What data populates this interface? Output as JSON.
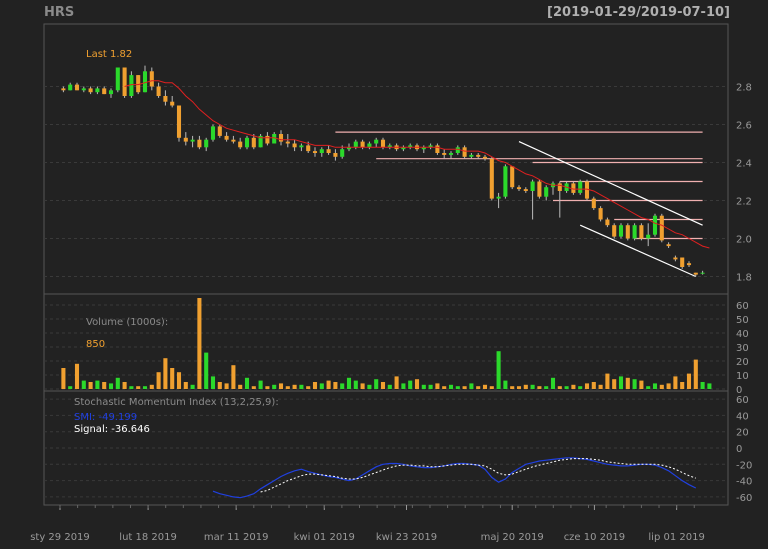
{
  "header": {
    "ticker": "HRS",
    "date_range": "[2019-01-29/2019-07-10]"
  },
  "colors": {
    "bg": "#222222",
    "panel": "#222222",
    "up": "#2bd92b",
    "down": "#f0a030",
    "grid": "#3a3a3a",
    "axis": "#999999",
    "sma": "#e02020",
    "smi": "#2040e0",
    "signal": "#ffffff",
    "hline": "#f0b0b0",
    "trend": "#ffffff",
    "last": "#f0a030"
  },
  "chart_data": [
    {
      "type": "candlestick",
      "panel": "price",
      "ylim": [
        1.75,
        2.95
      ],
      "yticks": [
        1.8,
        2.0,
        2.2,
        2.4,
        2.6,
        2.8
      ],
      "last_label": "Last 1.82",
      "sma_label": "",
      "candles": [
        [
          2.79,
          2.8,
          2.77,
          2.78
        ],
        [
          2.78,
          2.82,
          2.78,
          2.81
        ],
        [
          2.81,
          2.82,
          2.78,
          2.78
        ],
        [
          2.78,
          2.8,
          2.77,
          2.79
        ],
        [
          2.79,
          2.8,
          2.76,
          2.77
        ],
        [
          2.77,
          2.8,
          2.76,
          2.79
        ],
        [
          2.79,
          2.8,
          2.76,
          2.76
        ],
        [
          2.76,
          2.79,
          2.74,
          2.78
        ],
        [
          2.78,
          2.9,
          2.77,
          2.9
        ],
        [
          2.9,
          2.9,
          2.74,
          2.75
        ],
        [
          2.75,
          2.88,
          2.74,
          2.86
        ],
        [
          2.86,
          2.86,
          2.76,
          2.77
        ],
        [
          2.77,
          2.91,
          2.77,
          2.88
        ],
        [
          2.88,
          2.9,
          2.78,
          2.8
        ],
        [
          2.8,
          2.82,
          2.74,
          2.75
        ],
        [
          2.75,
          2.78,
          2.7,
          2.72
        ],
        [
          2.72,
          2.75,
          2.69,
          2.7
        ],
        [
          2.7,
          2.7,
          2.51,
          2.53
        ],
        [
          2.53,
          2.56,
          2.49,
          2.51
        ],
        [
          2.51,
          2.54,
          2.48,
          2.52
        ],
        [
          2.52,
          2.54,
          2.47,
          2.48
        ],
        [
          2.48,
          2.53,
          2.46,
          2.52
        ],
        [
          2.52,
          2.6,
          2.51,
          2.59
        ],
        [
          2.59,
          2.6,
          2.53,
          2.54
        ],
        [
          2.54,
          2.56,
          2.51,
          2.52
        ],
        [
          2.52,
          2.54,
          2.5,
          2.51
        ],
        [
          2.51,
          2.53,
          2.47,
          2.48
        ],
        [
          2.48,
          2.54,
          2.47,
          2.53
        ],
        [
          2.53,
          2.55,
          2.47,
          2.48
        ],
        [
          2.48,
          2.55,
          2.48,
          2.54
        ],
        [
          2.54,
          2.56,
          2.49,
          2.5
        ],
        [
          2.5,
          2.56,
          2.5,
          2.55
        ],
        [
          2.55,
          2.57,
          2.49,
          2.51
        ],
        [
          2.51,
          2.55,
          2.48,
          2.5
        ],
        [
          2.5,
          2.52,
          2.46,
          2.48
        ],
        [
          2.48,
          2.5,
          2.46,
          2.49
        ],
        [
          2.49,
          2.51,
          2.45,
          2.46
        ],
        [
          2.46,
          2.48,
          2.43,
          2.45
        ],
        [
          2.45,
          2.48,
          2.43,
          2.47
        ],
        [
          2.47,
          2.49,
          2.44,
          2.45
        ],
        [
          2.45,
          2.47,
          2.41,
          2.43
        ],
        [
          2.43,
          2.49,
          2.42,
          2.47
        ],
        [
          2.47,
          2.5,
          2.46,
          2.48
        ],
        [
          2.48,
          2.52,
          2.47,
          2.51
        ],
        [
          2.51,
          2.52,
          2.47,
          2.48
        ],
        [
          2.48,
          2.51,
          2.47,
          2.5
        ],
        [
          2.5,
          2.53,
          2.48,
          2.52
        ],
        [
          2.52,
          2.53,
          2.47,
          2.48
        ],
        [
          2.48,
          2.5,
          2.47,
          2.49
        ],
        [
          2.49,
          2.5,
          2.46,
          2.47
        ],
        [
          2.47,
          2.49,
          2.46,
          2.48
        ],
        [
          2.48,
          2.5,
          2.47,
          2.49
        ],
        [
          2.49,
          2.5,
          2.46,
          2.47
        ],
        [
          2.47,
          2.49,
          2.45,
          2.48
        ],
        [
          2.48,
          2.5,
          2.47,
          2.49
        ],
        [
          2.49,
          2.5,
          2.44,
          2.45
        ],
        [
          2.45,
          2.47,
          2.42,
          2.44
        ],
        [
          2.44,
          2.46,
          2.42,
          2.45
        ],
        [
          2.45,
          2.49,
          2.44,
          2.48
        ],
        [
          2.48,
          2.49,
          2.42,
          2.43
        ],
        [
          2.43,
          2.45,
          2.42,
          2.44
        ],
        [
          2.44,
          2.45,
          2.42,
          2.43
        ],
        [
          2.43,
          2.44,
          2.41,
          2.42
        ],
        [
          2.42,
          2.43,
          2.2,
          2.21
        ],
        [
          2.21,
          2.24,
          2.16,
          2.22
        ],
        [
          2.22,
          2.39,
          2.21,
          2.38
        ],
        [
          2.38,
          2.38,
          2.26,
          2.27
        ],
        [
          2.27,
          2.28,
          2.25,
          2.26
        ],
        [
          2.26,
          2.27,
          2.24,
          2.25
        ],
        [
          2.25,
          2.31,
          2.1,
          2.3
        ],
        [
          2.3,
          2.31,
          2.21,
          2.22
        ],
        [
          2.22,
          2.28,
          2.2,
          2.27
        ],
        [
          2.27,
          2.3,
          2.23,
          2.29
        ],
        [
          2.29,
          2.3,
          2.11,
          2.25
        ],
        [
          2.25,
          2.3,
          2.24,
          2.29
        ],
        [
          2.29,
          2.3,
          2.23,
          2.24
        ],
        [
          2.24,
          2.31,
          2.23,
          2.3
        ],
        [
          2.3,
          2.31,
          2.2,
          2.21
        ],
        [
          2.21,
          2.22,
          2.15,
          2.16
        ],
        [
          2.16,
          2.17,
          2.09,
          2.1
        ],
        [
          2.1,
          2.11,
          2.06,
          2.07
        ],
        [
          2.07,
          2.08,
          2.0,
          2.01
        ],
        [
          2.01,
          2.08,
          2.0,
          2.07
        ],
        [
          2.07,
          2.08,
          1.99,
          2.0
        ],
        [
          2.0,
          2.08,
          1.99,
          2.07
        ],
        [
          2.07,
          2.08,
          1.99,
          2.0
        ],
        [
          2.0,
          2.08,
          1.96,
          2.02
        ],
        [
          2.02,
          2.13,
          2.01,
          2.12
        ],
        [
          2.12,
          2.13,
          1.98,
          1.99
        ],
        [
          1.97,
          1.98,
          1.95,
          1.96
        ],
        [
          1.9,
          1.91,
          1.88,
          1.89
        ],
        [
          1.9,
          1.9,
          1.84,
          1.85
        ],
        [
          1.87,
          1.88,
          1.85,
          1.86
        ],
        [
          1.82,
          1.82,
          1.8,
          1.81
        ],
        [
          1.82,
          1.83,
          1.81,
          1.82
        ]
      ],
      "sma": [
        null,
        null,
        null,
        null,
        null,
        null,
        null,
        null,
        null,
        2.8,
        2.81,
        2.81,
        2.82,
        2.83,
        2.83,
        2.82,
        2.82,
        2.79,
        2.75,
        2.72,
        2.68,
        2.65,
        2.62,
        2.6,
        2.58,
        2.57,
        2.56,
        2.55,
        2.54,
        2.53,
        2.53,
        2.53,
        2.52,
        2.52,
        2.52,
        2.51,
        2.5,
        2.49,
        2.49,
        2.49,
        2.48,
        2.48,
        2.48,
        2.48,
        2.48,
        2.48,
        2.48,
        2.48,
        2.48,
        2.48,
        2.48,
        2.48,
        2.48,
        2.48,
        2.48,
        2.48,
        2.47,
        2.47,
        2.47,
        2.46,
        2.46,
        2.46,
        2.45,
        2.43,
        2.41,
        2.4,
        2.38,
        2.36,
        2.34,
        2.33,
        2.31,
        2.29,
        2.28,
        2.28,
        2.27,
        2.26,
        2.26,
        2.26,
        2.25,
        2.23,
        2.21,
        2.19,
        2.17,
        2.15,
        2.13,
        2.11,
        2.1,
        2.08,
        2.07,
        2.05,
        2.03,
        2.02,
        2.0,
        1.98,
        1.96,
        1.95
      ],
      "hlines": [
        {
          "y": 2.56,
          "from": 40,
          "to": 96
        },
        {
          "y": 2.42,
          "from": 46,
          "to": 96
        },
        {
          "y": 2.4,
          "from": 69,
          "to": 96
        },
        {
          "y": 2.3,
          "from": 73,
          "to": 96
        },
        {
          "y": 2.2,
          "from": 72,
          "to": 96
        },
        {
          "y": 2.1,
          "from": 81,
          "to": 96
        },
        {
          "y": 2.0,
          "from": 84,
          "to": 96
        }
      ],
      "trendlines": [
        {
          "x1": 67,
          "y1": 2.51,
          "x2": 96,
          "y2": 2.07
        },
        {
          "x1": 76,
          "y1": 2.07,
          "x2": 93,
          "y2": 1.8
        }
      ]
    },
    {
      "type": "bar",
      "panel": "volume",
      "title": "Volume (1000s):",
      "last_value": "850",
      "ylim": [
        0,
        65
      ],
      "yticks": [
        0,
        10,
        20,
        30,
        40,
        50,
        60
      ],
      "values": [
        15,
        2,
        18,
        6,
        5,
        6,
        5,
        4,
        8,
        5,
        2,
        2,
        2,
        3,
        12,
        22,
        15,
        12,
        5,
        3,
        65,
        26,
        9,
        5,
        4,
        17,
        3,
        8,
        2,
        6,
        2,
        3,
        4,
        2,
        3,
        3,
        2,
        5,
        4,
        6,
        5,
        4,
        8,
        6,
        4,
        3,
        7,
        5,
        3,
        9,
        4,
        6,
        7,
        3,
        3,
        4,
        2,
        3,
        2,
        2,
        4,
        2,
        3,
        2,
        27,
        6,
        2,
        2,
        3,
        3,
        2,
        2,
        8,
        2,
        2,
        3,
        2,
        4,
        5,
        3,
        11,
        7,
        9,
        8,
        7,
        6,
        2,
        4,
        3,
        4,
        9,
        5,
        11,
        21,
        5,
        4
      ]
    },
    {
      "type": "line",
      "panel": "smi",
      "title": "Stochastic Momentum Index (13,2,25,9):",
      "smi_label": "SMI: -49.199",
      "signal_label": "Signal: -36.646",
      "ylim": [
        -65,
        65
      ],
      "yticks": [
        -60,
        -40,
        -20,
        0,
        20,
        40,
        60
      ],
      "smi": [
        null,
        null,
        null,
        null,
        null,
        null,
        null,
        null,
        null,
        null,
        null,
        null,
        null,
        null,
        null,
        null,
        null,
        null,
        null,
        null,
        null,
        null,
        -53,
        -56,
        -58,
        -60,
        -61,
        -59,
        -56,
        -50,
        -45,
        -40,
        -35,
        -31,
        -28,
        -26,
        -29,
        -31,
        -33,
        -35,
        -36,
        -38,
        -40,
        -38,
        -33,
        -28,
        -23,
        -20,
        -19,
        -19,
        -20,
        -22,
        -23,
        -24,
        -24,
        -23,
        -22,
        -20,
        -19,
        -19,
        -20,
        -21,
        -26,
        -36,
        -42,
        -38,
        -30,
        -25,
        -20,
        -18,
        -16,
        -15,
        -14,
        -13,
        -12,
        -12,
        -13,
        -14,
        -16,
        -18,
        -20,
        -21,
        -22,
        -22,
        -21,
        -20,
        -20,
        -21,
        -24,
        -28,
        -34,
        -40,
        -45,
        -49
      ],
      "signal": [
        null,
        null,
        null,
        null,
        null,
        null,
        null,
        null,
        null,
        null,
        null,
        null,
        null,
        null,
        null,
        null,
        null,
        null,
        null,
        null,
        null,
        null,
        null,
        null,
        null,
        null,
        null,
        null,
        null,
        -54,
        -52,
        -48,
        -44,
        -40,
        -37,
        -34,
        -32,
        -32,
        -33,
        -34,
        -35,
        -37,
        -38,
        -38,
        -36,
        -33,
        -30,
        -27,
        -24,
        -22,
        -21,
        -21,
        -22,
        -22,
        -23,
        -23,
        -22,
        -21,
        -20,
        -20,
        -20,
        -21,
        -22,
        -26,
        -31,
        -33,
        -32,
        -29,
        -26,
        -23,
        -21,
        -19,
        -17,
        -15,
        -14,
        -13,
        -13,
        -13,
        -14,
        -15,
        -17,
        -18,
        -19,
        -20,
        -20,
        -20,
        -20,
        -20,
        -21,
        -23,
        -26,
        -30,
        -34,
        -37
      ]
    }
  ],
  "xaxis": {
    "labels": [
      {
        "i": 0,
        "text": "sty 29 2019"
      },
      {
        "i": 15,
        "text": "lut 18 2019"
      },
      {
        "i": 30,
        "text": "mar 11 2019"
      },
      {
        "i": 45,
        "text": "kwi 01 2019"
      },
      {
        "i": 59,
        "text": "kwi 23 2019"
      },
      {
        "i": 77,
        "text": "maj 20 2019"
      },
      {
        "i": 91,
        "text": "cze 10 2019"
      },
      {
        "i": 105,
        "text": "lip 01 2019"
      }
    ]
  }
}
